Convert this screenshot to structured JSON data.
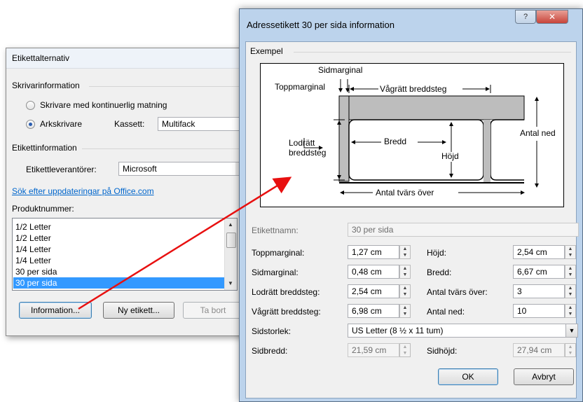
{
  "back_dialog": {
    "title": "Etikettalternativ",
    "printer_group": "Skrivarinformation",
    "radio_continuous": "Skrivare med kontinuerlig matning",
    "radio_sheet": "Arkskrivare",
    "tray_label": "Kassett:",
    "tray_value": "Multifack",
    "label_info_group": "Etikettinformation",
    "vendor_label": "Etikettleverantörer:",
    "vendor_value": "Microsoft",
    "update_link": "Sök efter uppdateringar på Office.com",
    "product_number_label": "Produktnummer:",
    "product_items": [
      "1/2 Letter",
      "1/2 Letter",
      "1/4 Letter",
      "1/4 Letter",
      "30 per sida",
      "30 per sida"
    ],
    "selected_index": 5,
    "details_button": "Information...",
    "new_label_button": "Ny etikett...",
    "delete_button": "Ta bort"
  },
  "front_dialog": {
    "title": "Adressetikett 30 per sida information",
    "help_glyph": "?",
    "close_glyph": "✕",
    "preview_group": "Exempel",
    "diagram": {
      "side_margin": "Sidmarginal",
      "top_margin": "Toppmarginal",
      "horizontal_pitch": "Vågrätt breddsteg",
      "vertical_pitch_1": "Lodrätt",
      "vertical_pitch_2": "breddsteg",
      "width": "Bredd",
      "height": "Höjd",
      "number_down": "Antal ned",
      "number_across": "Antal tvärs över"
    },
    "label_name_label": "Etikettnamn:",
    "label_name_value": "30 per sida",
    "top_margin_label": "Toppmarginal:",
    "top_margin_value": "1,27 cm",
    "height_label": "Höjd:",
    "height_value": "2,54 cm",
    "side_margin_label": "Sidmarginal:",
    "side_margin_value": "0,48 cm",
    "width_label": "Bredd:",
    "width_value": "6,67 cm",
    "vertical_pitch_label": "Lodrätt breddsteg:",
    "vertical_pitch_value": "2,54 cm",
    "number_across_label": "Antal tvärs över:",
    "number_across_value": "3",
    "horizontal_pitch_label": "Vågrätt breddsteg:",
    "horizontal_pitch_value": "6,98 cm",
    "number_down_label": "Antal ned:",
    "number_down_value": "10",
    "page_size_label": "Sidstorlek:",
    "page_size_value": "US Letter (8 ½ x 11 tum)",
    "page_width_label": "Sidbredd:",
    "page_width_value": "21,59 cm",
    "page_height_label": "Sidhöjd:",
    "page_height_value": "27,94 cm",
    "ok_button": "OK",
    "cancel_button": "Avbryt"
  },
  "colors": {
    "annotation_arrow": "#e81010",
    "selection": "#3399ff",
    "link": "#0066cc",
    "close_button": "#c8443a"
  }
}
